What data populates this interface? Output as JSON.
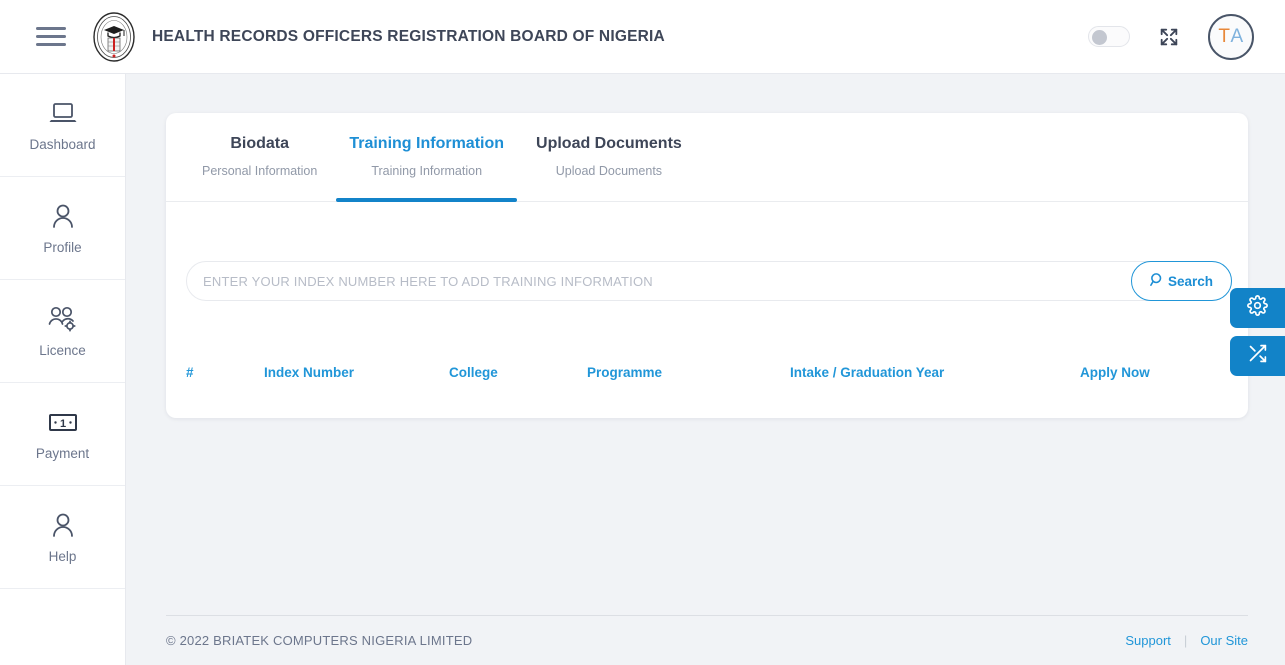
{
  "header": {
    "menu_icon": "hamburger-menu-icon",
    "logo_icon": "hrorbn-seal-logo",
    "title": "HEALTH RECORDS OFFICERS REGISTRATION BOARD OF NIGERIA",
    "theme_toggle": {
      "icon": "toggle-switch-icon",
      "state": "off"
    },
    "fullscreen_icon": "fullscreen-expand-icon",
    "avatar": {
      "initial_first": "T",
      "initial_second": "A"
    }
  },
  "sidebar": {
    "items": [
      {
        "label": "Dashboard",
        "icon": "laptop-icon"
      },
      {
        "label": "Profile",
        "icon": "person-icon"
      },
      {
        "label": "Licence",
        "icon": "users-gear-icon"
      },
      {
        "label": "Payment",
        "icon": "banknote-icon"
      },
      {
        "label": "Help",
        "icon": "person-icon"
      }
    ]
  },
  "main": {
    "tabs": [
      {
        "title": "Biodata",
        "subtitle": "Personal Information",
        "active": false
      },
      {
        "title": "Training Information",
        "subtitle": "Training Information",
        "active": true
      },
      {
        "title": "Upload Documents",
        "subtitle": "Upload Documents",
        "active": false
      }
    ],
    "search": {
      "placeholder": "ENTER YOUR INDEX NUMBER HERE TO ADD TRAINING INFORMATION",
      "value": "",
      "button_label": "Search",
      "button_icon": "search-icon"
    },
    "table": {
      "columns": [
        "#",
        "Index Number",
        "College",
        "Programme",
        "Intake / Graduation Year",
        "Apply Now"
      ],
      "rows": []
    }
  },
  "fabs": [
    {
      "name": "settings",
      "icon": "gear-icon"
    },
    {
      "name": "shuffle",
      "icon": "shuffle-icon"
    }
  ],
  "footer": {
    "copyright": "© 2022 BRIATEK COMPUTERS NIGERIA LIMITED",
    "links": [
      {
        "label": "Support"
      },
      {
        "label": "Our Site"
      }
    ],
    "separator": "|"
  },
  "colors": {
    "accent_blue": "#2196d8",
    "active_tab_underline": "#1383c9",
    "fab_blue": "#1283c8",
    "page_background": "#f1f3f6",
    "text_dark": "#3e4658",
    "text_muted": "#6c768c"
  }
}
